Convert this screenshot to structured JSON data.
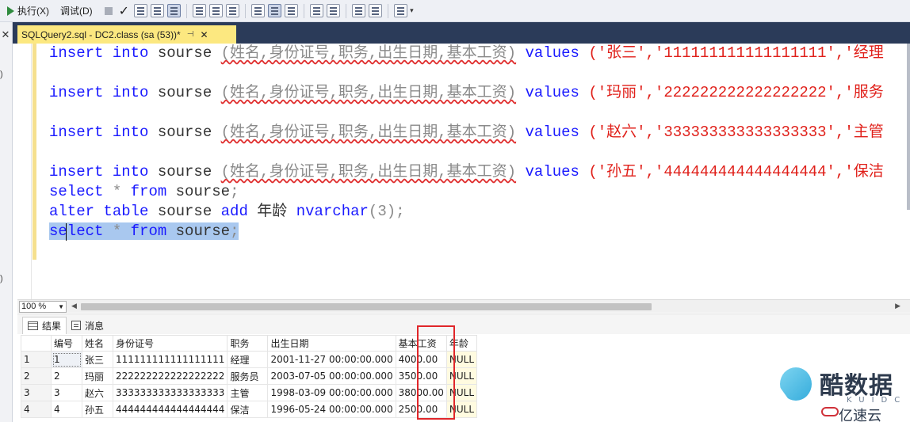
{
  "toolbar": {
    "execute_label": "执行(X)",
    "debug_label": "调试(D)"
  },
  "tabs": {
    "active_title": "SQLQuery2.sql - DC2.class (sa (53))*",
    "pin": "⊣",
    "close": "✕"
  },
  "editor": {
    "lines": [
      {
        "kw": "insert into",
        "obj": "sourse",
        "cols": "(姓名,身份证号,职务,出生日期,基本工资)",
        "values_kw": "values",
        "vals": "('张三','111111111111111111','经理"
      },
      {
        "kw": "insert into",
        "obj": "sourse",
        "cols": "(姓名,身份证号,职务,出生日期,基本工资)",
        "values_kw": "values",
        "vals": "('玛丽','222222222222222222','服务"
      },
      {
        "kw": "insert into",
        "obj": "sourse",
        "cols": "(姓名,身份证号,职务,出生日期,基本工资)",
        "values_kw": "values",
        "vals": "('赵六','333333333333333333','主管"
      },
      {
        "kw": "insert into",
        "obj": "sourse",
        "cols": "(姓名,身份证号,职务,出生日期,基本工资)",
        "values_kw": "values",
        "vals": "('孙五','444444444444444444','保洁"
      }
    ],
    "select1": {
      "kw1": "select",
      "star": "*",
      "kw2": "from",
      "obj": "sourse",
      "end": ";"
    },
    "alter": {
      "kw": "alter table",
      "obj": "sourse",
      "kw2": "add",
      "col": "年龄",
      "type": "nvarchar",
      "arg": "(3);"
    },
    "select2": {
      "kw1": "select",
      "star": "*",
      "kw2": "from",
      "obj": "sourse",
      "end": ";"
    }
  },
  "zoom": {
    "value": "100 %"
  },
  "result_tabs": {
    "results": "结果",
    "messages": "消息"
  },
  "grid": {
    "columns": [
      "编号",
      "姓名",
      "身份证号",
      "职务",
      "出生日期",
      "基本工资",
      "年龄"
    ],
    "rows": [
      {
        "n": "1",
        "id": "1",
        "name": "张三",
        "idcard": "111111111111111111",
        "job": "经理",
        "birth": "2001-11-27 00:00:00.000",
        "salary": "4000.00",
        "age": "NULL"
      },
      {
        "n": "2",
        "id": "2",
        "name": "玛丽",
        "idcard": "222222222222222222",
        "job": "服务员",
        "birth": "2003-07-05 00:00:00.000",
        "salary": "3500.00",
        "age": "NULL"
      },
      {
        "n": "3",
        "id": "3",
        "name": "赵六",
        "idcard": "333333333333333333",
        "job": "主管",
        "birth": "1998-03-09 00:00:00.000",
        "salary": "38000.00",
        "age": "NULL"
      },
      {
        "n": "4",
        "id": "4",
        "name": "孙五",
        "idcard": "444444444444444444",
        "job": "保洁",
        "birth": "1996-05-24 00:00:00.000",
        "salary": "2500.00",
        "age": "NULL"
      }
    ]
  },
  "watermark": {
    "main": "酷数据",
    "sub": "KUIDC",
    "brand": "亿速云"
  },
  "colors": {
    "keyword": "#1a1aff",
    "string": "#e0201a",
    "selection": "#a9c8ef",
    "tab_active": "#fce880",
    "highlight_box": "#e0262a"
  }
}
